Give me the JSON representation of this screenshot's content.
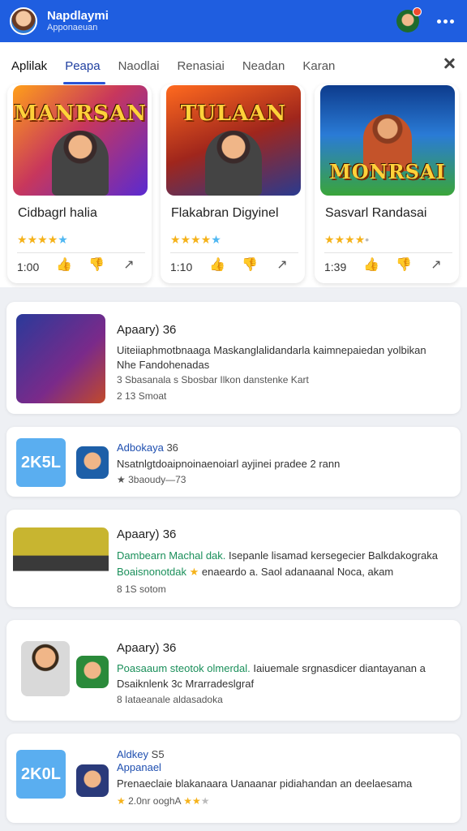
{
  "header": {
    "title": "Napdlaymi",
    "subtitle": "Apponaeuan",
    "accent": "#1f5ee0"
  },
  "tabs": [
    "Aplilak",
    "Peapa",
    "Naodlai",
    "Renasiai",
    "Neadan",
    "Karan"
  ],
  "featured": [
    {
      "logo": "MANRSAN",
      "title": "Cidbagrl halia",
      "rating": "4.5",
      "count": "1:00"
    },
    {
      "logo": "TULAAN",
      "title": "Flakabran Digyinel",
      "rating": "4.5",
      "count": "1:10"
    },
    {
      "logo": "MONRSAI",
      "title": "Sasvarl Randasai",
      "rating": "4",
      "count": "1:39"
    }
  ],
  "list": [
    {
      "title": "Apaary) 36",
      "desc": "Uiteiiaphmotbnaaga Maskanglalidandarla kaimnepaiedan yolbikan",
      "desc2": "Nhe Fandohenadas",
      "meta1": "3 Sbasanala s Sbosbar Ilkon danstenke Kart",
      "meta2": "2 13 Smoat"
    },
    {
      "badge": "2K5L",
      "title": "Adbokaya",
      "title_num": "36",
      "desc": "Nsatnlgtdoaipnoinaenoiarl ayjinei pradee 2 rann",
      "meta1": "★ 3baoudy—73"
    },
    {
      "title": "Apaary) 36",
      "desc_green": "Dambearn Machal dak.",
      "desc": "Isepanle lisamad kersegecier Balkdakograka",
      "desc2_green": "Boaisnonotdak",
      "desc2": "enaeardo a. Saol adanaanal Noca, akam",
      "meta1": "8 1S sotom"
    },
    {
      "title": "Apaary) 36",
      "desc_green": "Poasaaum steotok olmerdal.",
      "desc": "Iaiuemale srgnasdicer diantayanan a",
      "desc2": "Dsaiknlenk 3c Mrarradeslgraf",
      "meta1": "8 Iataeanale aldasadoka"
    },
    {
      "badge": "2K0L",
      "title": "Aldkey",
      "title_num": "S5",
      "subtitle": "Appanael",
      "desc": "Prenaeclaie blakanaara Uanaanar pidiahandan an deelaesama",
      "meta1": "2.0nr ooghA"
    }
  ]
}
